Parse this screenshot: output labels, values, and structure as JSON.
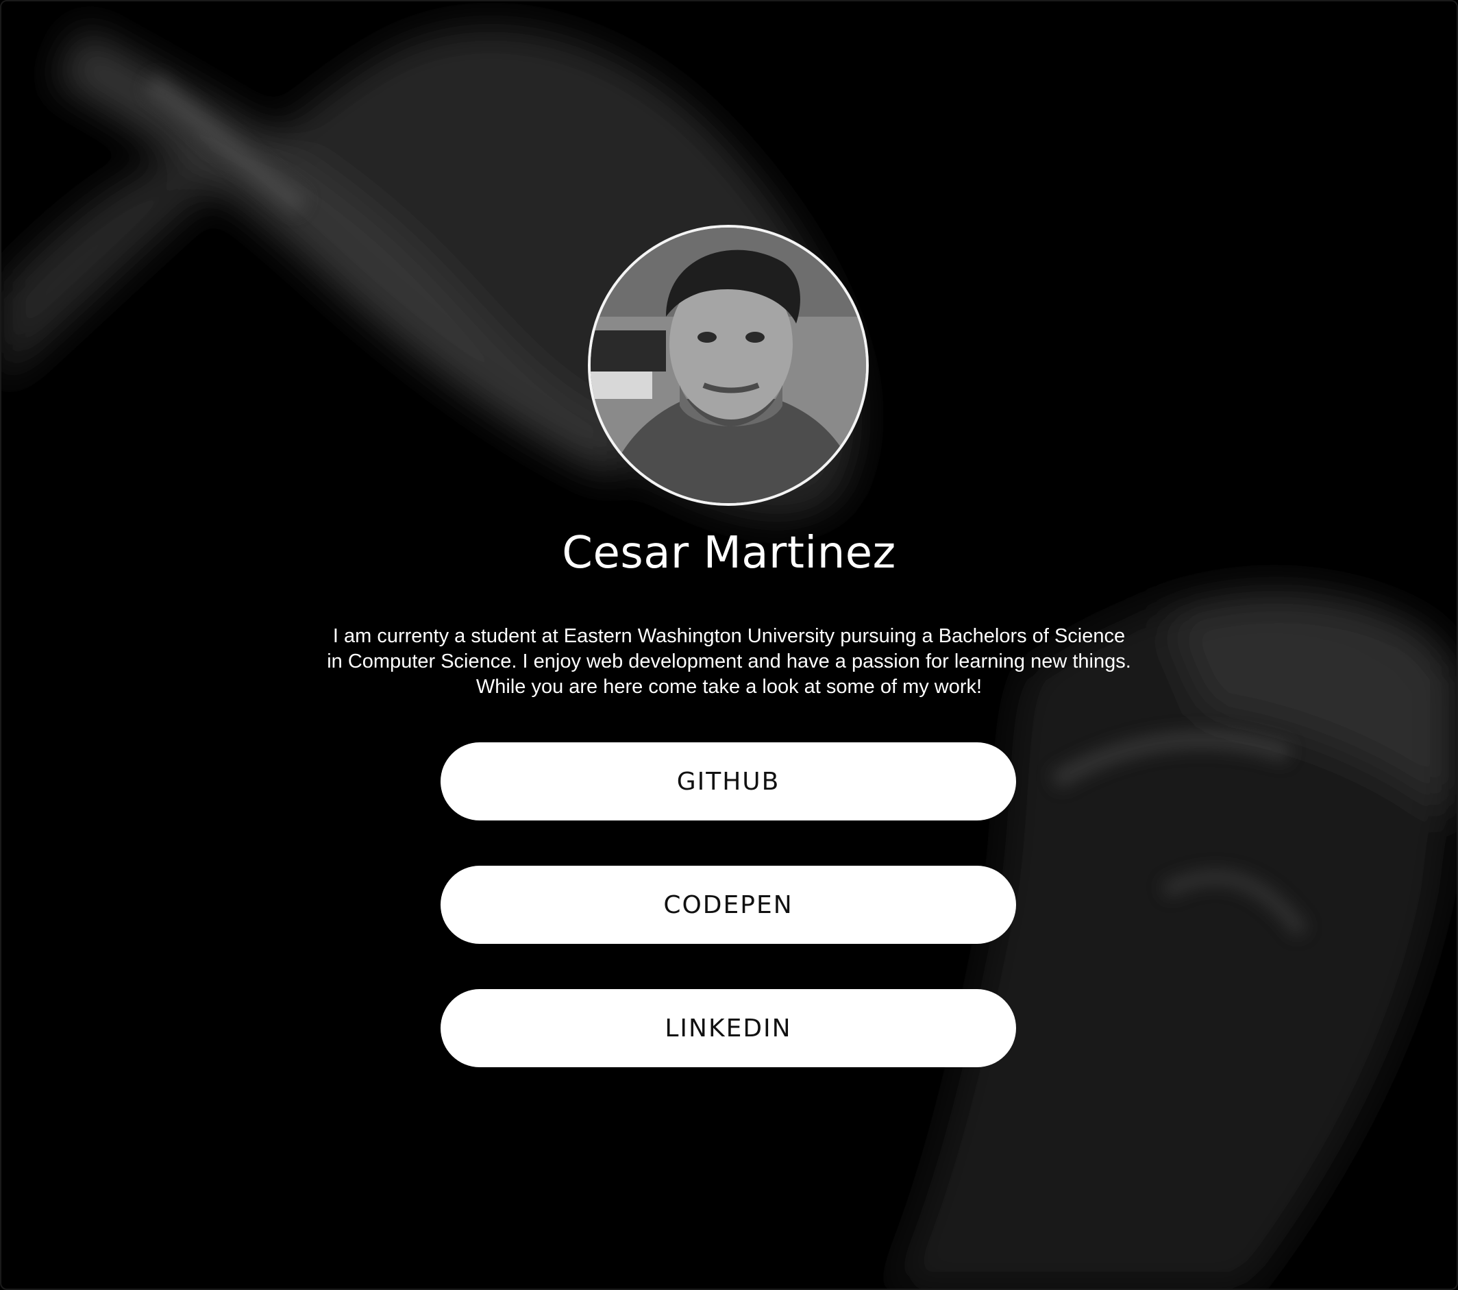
{
  "profile": {
    "name": "Cesar Martinez",
    "bio": "I am currenty a student at Eastern Washington University pursuing a Bachelors of Science in Computer Science. I enjoy web development and have a passion for learning new things. While you are here come take a look at some of my work!"
  },
  "links": {
    "github": "GITHUB",
    "codepen": "CODEPEN",
    "linkedin": "LINKEDIN"
  },
  "colors": {
    "background": "#000000",
    "button": "#ffffff",
    "button_text": "#111111",
    "text": "#ffffff"
  }
}
